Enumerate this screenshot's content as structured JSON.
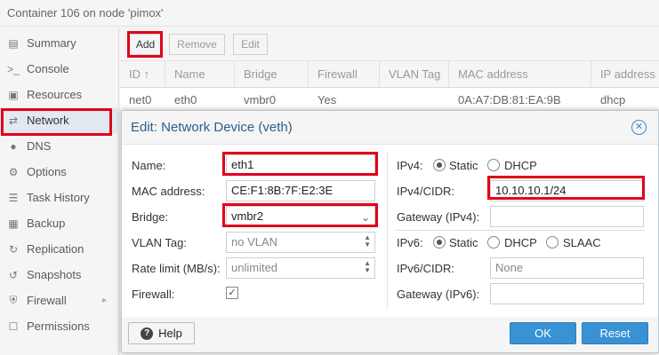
{
  "window": {
    "title": "Container 106 on node 'pimox'"
  },
  "sidebar": {
    "items": [
      {
        "label": "Summary",
        "icon": "book-icon"
      },
      {
        "label": "Console",
        "icon": "terminal-icon"
      },
      {
        "label": "Resources",
        "icon": "cube-icon"
      },
      {
        "label": "Network",
        "icon": "exchange-icon",
        "active": true
      },
      {
        "label": "DNS",
        "icon": "globe-icon"
      },
      {
        "label": "Options",
        "icon": "gear-icon"
      },
      {
        "label": "Task History",
        "icon": "list-icon"
      },
      {
        "label": "Backup",
        "icon": "floppy-icon"
      },
      {
        "label": "Replication",
        "icon": "retweet-icon"
      },
      {
        "label": "Snapshots",
        "icon": "history-icon"
      },
      {
        "label": "Firewall",
        "icon": "shield-icon"
      },
      {
        "label": "Permissions",
        "icon": "unlock-icon"
      }
    ]
  },
  "toolbar": {
    "add": "Add",
    "remove": "Remove",
    "edit": "Edit"
  },
  "grid": {
    "columns": [
      "ID",
      "Name",
      "Bridge",
      "Firewall",
      "VLAN Tag",
      "MAC address",
      "IP address"
    ],
    "rows": [
      {
        "id": "net0",
        "name": "eth0",
        "bridge": "vmbr0",
        "firewall": "Yes",
        "vlan": "",
        "mac": "0A:A7:DB:81:EA:9B",
        "ip": "dhcp"
      }
    ]
  },
  "dialog": {
    "title": "Edit: Network Device (veth)",
    "name_label": "Name:",
    "name_value": "eth1",
    "mac_label": "MAC address:",
    "mac_value": "CE:F1:8B:7F:E2:3E",
    "bridge_label": "Bridge:",
    "bridge_value": "vmbr2",
    "vlan_label": "VLAN Tag:",
    "vlan_placeholder": "no VLAN",
    "rate_label": "Rate limit (MB/s):",
    "rate_placeholder": "unlimited",
    "firewall_label": "Firewall:",
    "firewall_checked": true,
    "ipv4_label": "IPv4:",
    "ipv4_static": "Static",
    "ipv4_dhcp": "DHCP",
    "ipv4_mode": "Static",
    "ipv4_cidr_label": "IPv4/CIDR:",
    "ipv4_cidr_value": "10.10.10.1/24",
    "gw4_label": "Gateway (IPv4):",
    "gw4_value": "",
    "ipv6_label": "IPv6:",
    "ipv6_static": "Static",
    "ipv6_dhcp": "DHCP",
    "ipv6_slaac": "SLAAC",
    "ipv6_mode": "Static",
    "ipv6_cidr_label": "IPv6/CIDR:",
    "ipv6_cidr_placeholder": "None",
    "gw6_label": "Gateway (IPv6):",
    "gw6_value": "",
    "help": "Help",
    "ok": "OK",
    "reset": "Reset"
  },
  "colors": {
    "accent": "#3892d4",
    "highlight": "#e0001b",
    "title": "#2b5f8d"
  }
}
